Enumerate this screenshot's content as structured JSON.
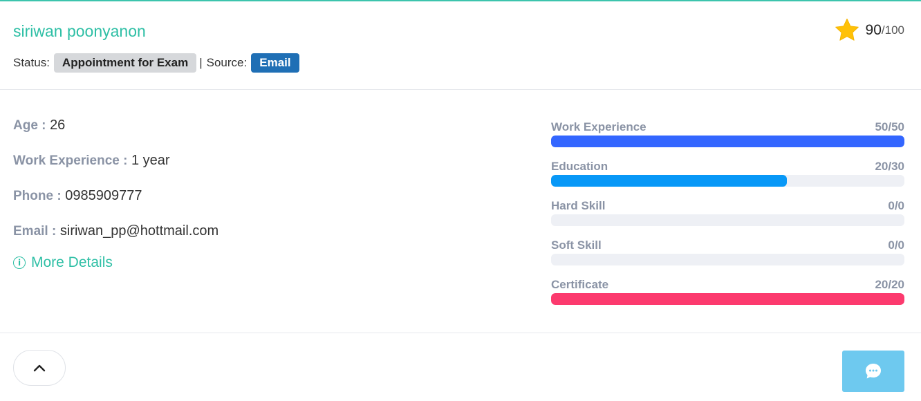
{
  "candidate": {
    "name": "siriwan poonyanon",
    "status_label": "Status:",
    "status_value": "Appointment for Exam",
    "separator": "|",
    "source_label": "Source:",
    "source_value": "Email",
    "score": "90",
    "score_max": "/100",
    "score_icon": "star-icon"
  },
  "info": [
    {
      "label": "Age :",
      "value": "26"
    },
    {
      "label": "Work Experience :",
      "value": "1 year"
    },
    {
      "label": "Phone :",
      "value": "0985909777"
    },
    {
      "label": "Email :",
      "value": "siriwan_pp@hottmail.com"
    }
  ],
  "more_details": "More Details",
  "skills": [
    {
      "label": "Work Experience",
      "score": "50/50",
      "fraction": 1.0,
      "color": "#3366ff"
    },
    {
      "label": "Education",
      "score": "20/30",
      "fraction": 0.6667,
      "color": "#0898f7"
    },
    {
      "label": "Hard Skill",
      "score": "0/0",
      "fraction": 0,
      "color": "#3366ff"
    },
    {
      "label": "Soft Skill",
      "score": "0/0",
      "fraction": 0,
      "color": "#3366ff"
    },
    {
      "label": "Certificate",
      "score": "20/20",
      "fraction": 1.0,
      "color": "#fc3a6e"
    }
  ],
  "colors": {
    "accent": "#2ebfa5",
    "source_badge": "#1f6fb5",
    "chat_button": "#6ec9ef"
  },
  "footer": {
    "up_icon": "chevron-up-icon",
    "chat_icon": "chat-bubble-icon"
  }
}
